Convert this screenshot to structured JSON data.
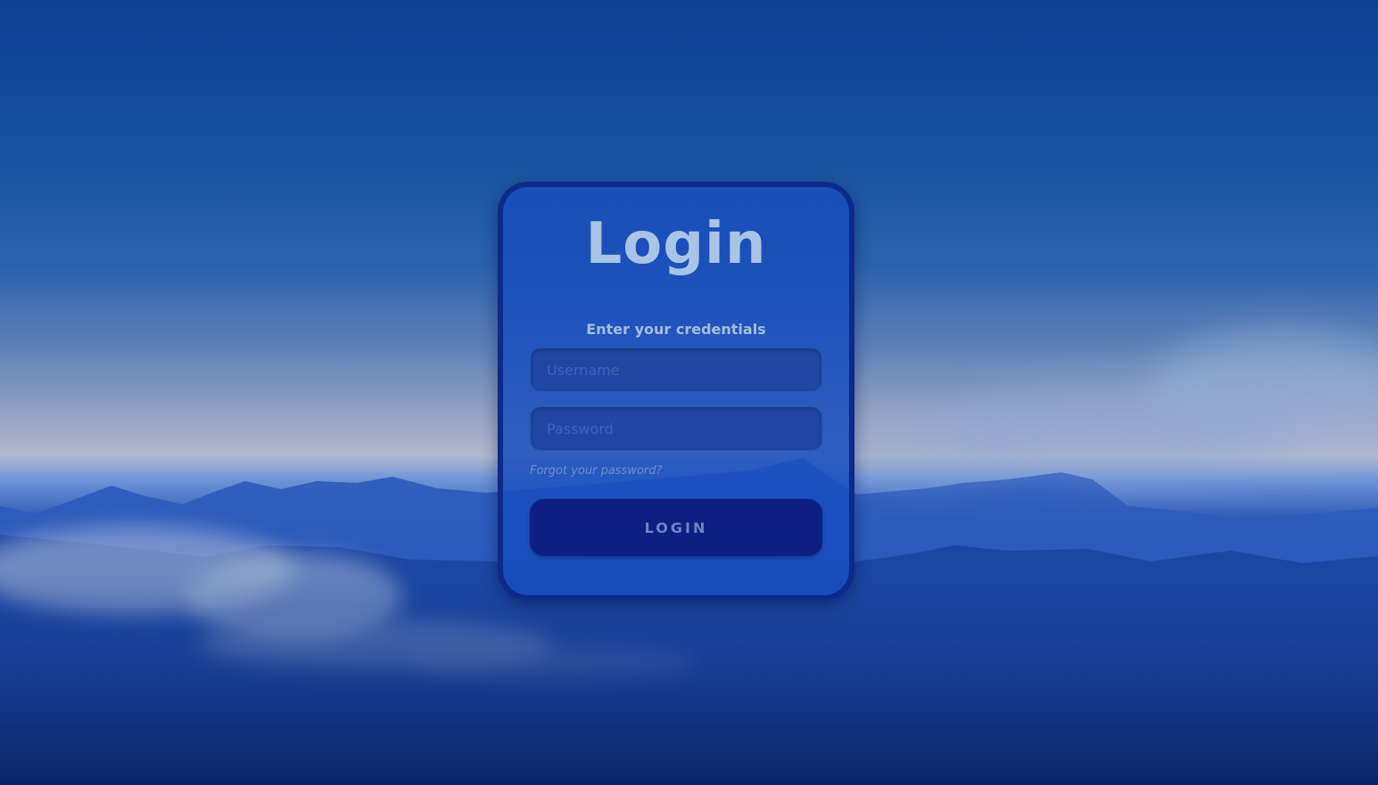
{
  "login": {
    "title": "Login",
    "subtitle": "Enter your credentials",
    "username": {
      "placeholder": "Username",
      "value": ""
    },
    "password": {
      "placeholder": "Password",
      "value": ""
    },
    "forgot_password": "Forgot your password?",
    "submit_label": "LOGIN"
  },
  "theme": {
    "card_background": "#1a4ebe",
    "card_border": "#0c2a8a",
    "title_color": "#a9c4e4",
    "button_background": "#0e1f84",
    "button_text": "#6f85c8"
  }
}
